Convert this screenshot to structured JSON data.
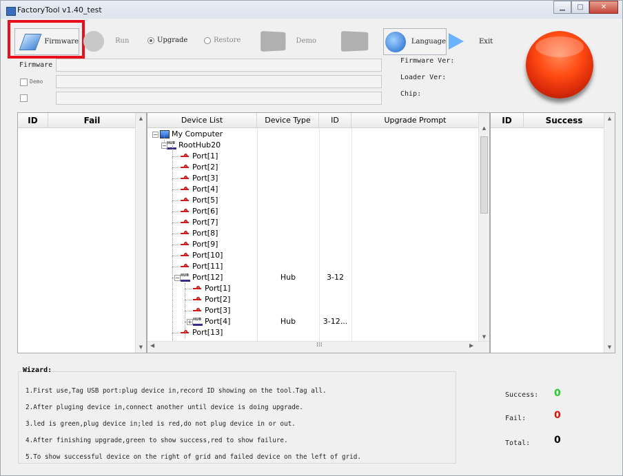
{
  "window": {
    "title": "FactoryTool v1.40_test"
  },
  "toolbar": {
    "firmware_label": "Firmware",
    "run_label": "Run",
    "upgrade_label": "Upgrade",
    "restore_label": "Restore",
    "demo_label": "Demo",
    "language_label": "Language",
    "exit_label": "Exit",
    "selected_mode": "Upgrade"
  },
  "info": {
    "firmware_label": "Firmware",
    "demo_label": "Demo",
    "firmware_ver_label": "Firmware Ver:",
    "loader_ver_label": "Loader Ver:",
    "chip_label": "Chip:"
  },
  "fail_grid": {
    "headers": [
      "ID",
      "Fail"
    ]
  },
  "success_grid": {
    "headers": [
      "ID",
      "Success"
    ]
  },
  "device_grid": {
    "headers": [
      "Device List",
      "Device Type",
      "ID",
      "Upgrade Prompt"
    ],
    "rows": [
      {
        "name": "My Computer",
        "icon": "computer-icon",
        "level": 0,
        "type": "",
        "id": ""
      },
      {
        "name": "RootHub20",
        "icon": "hub-icon",
        "level": 1,
        "type": "",
        "id": ""
      },
      {
        "name": "Port[1]",
        "icon": "usb-icon",
        "level": 2,
        "type": "",
        "id": ""
      },
      {
        "name": "Port[2]",
        "icon": "usb-icon",
        "level": 2,
        "type": "",
        "id": ""
      },
      {
        "name": "Port[3]",
        "icon": "usb-icon",
        "level": 2,
        "type": "",
        "id": ""
      },
      {
        "name": "Port[4]",
        "icon": "usb-icon",
        "level": 2,
        "type": "",
        "id": ""
      },
      {
        "name": "Port[5]",
        "icon": "usb-icon",
        "level": 2,
        "type": "",
        "id": ""
      },
      {
        "name": "Port[6]",
        "icon": "usb-icon",
        "level": 2,
        "type": "",
        "id": ""
      },
      {
        "name": "Port[7]",
        "icon": "usb-icon",
        "level": 2,
        "type": "",
        "id": ""
      },
      {
        "name": "Port[8]",
        "icon": "usb-icon",
        "level": 2,
        "type": "",
        "id": ""
      },
      {
        "name": "Port[9]",
        "icon": "usb-icon",
        "level": 2,
        "type": "",
        "id": ""
      },
      {
        "name": "Port[10]",
        "icon": "usb-icon",
        "level": 2,
        "type": "",
        "id": ""
      },
      {
        "name": "Port[11]",
        "icon": "usb-icon",
        "level": 2,
        "type": "",
        "id": ""
      },
      {
        "name": "Port[12]",
        "icon": "hub-icon",
        "level": 2,
        "type": "Hub",
        "id": "3-12"
      },
      {
        "name": "Port[1]",
        "icon": "usb-icon",
        "level": 3,
        "type": "",
        "id": ""
      },
      {
        "name": "Port[2]",
        "icon": "usb-icon",
        "level": 3,
        "type": "",
        "id": ""
      },
      {
        "name": "Port[3]",
        "icon": "usb-icon",
        "level": 3,
        "type": "",
        "id": ""
      },
      {
        "name": "Port[4]",
        "icon": "hub-icon",
        "level": 3,
        "type": "Hub",
        "id": "3-12..."
      },
      {
        "name": "Port[13]",
        "icon": "usb-icon",
        "level": 2,
        "type": "",
        "id": ""
      }
    ]
  },
  "wizard": {
    "title": "Wizard:",
    "lines": [
      "1.First use,Tag USB port:plug device in,record ID showing on the tool.Tag all.",
      "2.After pluging device in,connect another until device is doing upgrade.",
      "3.led is green,plug device in;led is red,do not plug device in or out.",
      "4.After finishing upgrade,green to show success,red to show failure.",
      "5.To show successful device on the right of grid and failed device on the left of grid."
    ]
  },
  "stats": {
    "success_label": "Success:",
    "success_value": "0",
    "fail_label": "Fail:",
    "fail_value": "0",
    "total_label": "Total:",
    "total_value": "0"
  },
  "colors": {
    "success": "#22cc22",
    "fail": "#e01010",
    "total": "#000000",
    "highlight": "#e8101b"
  }
}
